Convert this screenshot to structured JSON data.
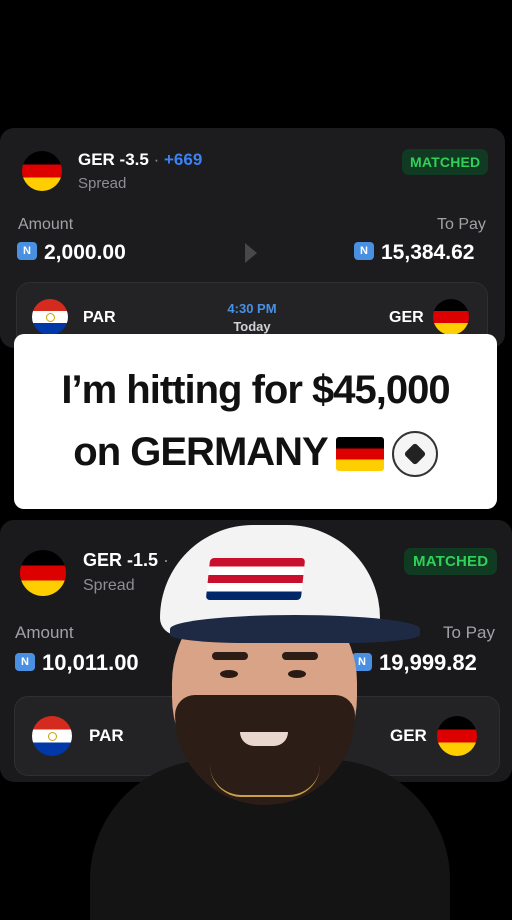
{
  "bet1": {
    "selection": "GER -3.5",
    "separator": "·",
    "odds": "+669",
    "type": "Spread",
    "status": "MATCHED",
    "amount_label": "Amount",
    "amount": "2,000.00",
    "topay_label": "To Pay",
    "topay": "15,384.62",
    "match": {
      "home": "PAR",
      "away": "GER",
      "time": "4:30 PM",
      "day": "Today"
    }
  },
  "caption": {
    "line1": "I’m hitting for $45,000",
    "line2": "on GERMANY"
  },
  "bet2": {
    "selection": "GER -1.5",
    "separator": "·",
    "type": "Spread",
    "status": "MATCHED",
    "amount_label": "Amount",
    "amount": "10,011.00",
    "topay_label": "To Pay",
    "topay": "19,999.82",
    "match": {
      "home": "PAR",
      "away": "GER"
    }
  },
  "icons": {
    "coin": "N",
    "germany_flag": "flag-germany-icon",
    "paraguay_flag": "flag-paraguay-icon",
    "soccer_ball": "soccer-ball-icon"
  },
  "colors": {
    "matched_green": "#30d158",
    "odds_blue": "#3b82f6",
    "card_bg": "#1c1c1e"
  }
}
